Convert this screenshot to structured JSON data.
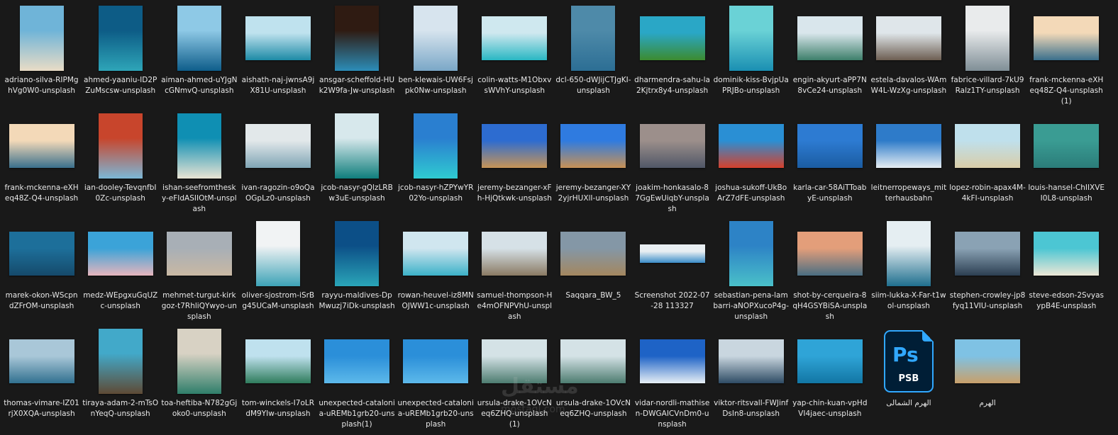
{
  "files": [
    {
      "name": "adriano-silva-RIPMghVg0W0-unsplash",
      "shape": "p",
      "colors": [
        "#6fb4d8",
        "#e9dcc6"
      ]
    },
    {
      "name": "ahmed-yaaniu-ID2PZuMscsw-unsplash",
      "shape": "p",
      "colors": [
        "#0d5c86",
        "#2ea5b8"
      ]
    },
    {
      "name": "aiman-ahmed-uYJgNcGNmvQ-unsplash",
      "shape": "p",
      "colors": [
        "#8ec9e6",
        "#0e5d8a"
      ]
    },
    {
      "name": "aishath-naj-jwnsA9jX81U-unsplash",
      "shape": "l",
      "colors": [
        "#bfe2ee",
        "#1d8aa6"
      ]
    },
    {
      "name": "ansgar-scheffold-HUk2W9fa-Jw-unsplash",
      "shape": "p",
      "colors": [
        "#2f1b12",
        "#2c8db8"
      ]
    },
    {
      "name": "ben-klewais-UW6Fsjpk0Nw-unsplash",
      "shape": "p",
      "colors": [
        "#d7e4ee",
        "#7aa7c7"
      ]
    },
    {
      "name": "colin-watts-M1ObxvsWVhY-unsplash",
      "shape": "l",
      "colors": [
        "#cfe8ef",
        "#29b7c3"
      ]
    },
    {
      "name": "dcl-650-dWJijCTJgKI-unsplash",
      "shape": "p",
      "colors": [
        "#4e8aa9",
        "#2c6e94"
      ]
    },
    {
      "name": "dharmendra-sahu-la2Kjtrx8y4-unsplash",
      "shape": "l",
      "colors": [
        "#2aa7c6",
        "#3c8b2f"
      ]
    },
    {
      "name": "dominik-kiss-BvjpUaPRJBo-unsplash",
      "shape": "p",
      "colors": [
        "#6ad2d6",
        "#1a8fb2"
      ]
    },
    {
      "name": "engin-akyurt-aPP7N8vCe24-unsplash",
      "shape": "l",
      "colors": [
        "#d9e6ec",
        "#3d7f6a"
      ]
    },
    {
      "name": "estela-davalos-WAmW4L-WzXg-unsplash",
      "shape": "l",
      "colors": [
        "#dfe6ea",
        "#6d5e52"
      ]
    },
    {
      "name": "fabrice-villard-7kU9Ralz1TY-unsplash",
      "shape": "p",
      "colors": [
        "#e9ebec",
        "#7f8e96"
      ]
    },
    {
      "name": "frank-mckenna-eXHeq48Z-Q4-unsplash(1)",
      "shape": "l",
      "colors": [
        "#f3d9b8",
        "#3a6f8c"
      ]
    },
    {
      "name": "frank-mckenna-eXHeq48Z-Q4-unsplash",
      "shape": "l",
      "colors": [
        "#f3d9b8",
        "#3a6f8c"
      ]
    },
    {
      "name": "ian-dooley-TevqnfbI0Zc-unsplash",
      "shape": "p",
      "colors": [
        "#c8452c",
        "#7cb7d6"
      ]
    },
    {
      "name": "ishan-seefromthesky-eFIdASIIOtM-unsplash",
      "shape": "p",
      "colors": [
        "#0f8fb3",
        "#e9e4d4"
      ]
    },
    {
      "name": "ivan-ragozin-o9oQaOGpLz0-unsplash",
      "shape": "l",
      "colors": [
        "#e2e8ea",
        "#7fa5b5"
      ]
    },
    {
      "name": "jcob-nasyr-gQlzLRBw3uE-unsplash",
      "shape": "p",
      "colors": [
        "#d7e8ec",
        "#0f7e7c"
      ]
    },
    {
      "name": "jcob-nasyr-hZPYwYR02Yo-unsplash",
      "shape": "p",
      "colors": [
        "#2a7fd0",
        "#2fcbd1"
      ]
    },
    {
      "name": "jeremy-bezanger-xFh-HjQtkwk-unsplash",
      "shape": "l",
      "colors": [
        "#2d6cd0",
        "#c79456"
      ]
    },
    {
      "name": "jeremy-bezanger-XY2yjrHUXlI-unsplash",
      "shape": "l",
      "colors": [
        "#2f7be0",
        "#c89155"
      ]
    },
    {
      "name": "joakim-honkasalo-87GgEwUiqbY-unsplash",
      "shape": "l",
      "colors": [
        "#9c8f8b",
        "#505767"
      ]
    },
    {
      "name": "joshua-sukoff-UkBoArZ7dFE-unsplash",
      "shape": "l",
      "colors": [
        "#2a8fd4",
        "#d5402c"
      ]
    },
    {
      "name": "karla-car-58AiTToabyE-unsplash",
      "shape": "l",
      "colors": [
        "#2d7bd2",
        "#1b5ca1"
      ]
    },
    {
      "name": "leitnerropeways_mitterhausbahn",
      "shape": "l",
      "colors": [
        "#2e7bc9",
        "#e6eef3"
      ]
    },
    {
      "name": "lopez-robin-apax4M-4kFI-unsplash",
      "shape": "l",
      "colors": [
        "#bfe0ec",
        "#d9cda8"
      ]
    },
    {
      "name": "louis-hansel-ChIIXVEI0L8-unsplash",
      "shape": "l",
      "colors": [
        "#3a9c93",
        "#2b7c79"
      ]
    },
    {
      "name": "marek-okon-WScpndZFrOM-unsplash",
      "shape": "l",
      "colors": [
        "#1d6f9a",
        "#154a6b"
      ]
    },
    {
      "name": "medz-WEpgxuGqUZc-unsplash",
      "shape": "l",
      "colors": [
        "#3ba3d8",
        "#e6b5bd"
      ]
    },
    {
      "name": "mehmet-turgut-kirkgoz-t7RhliQYwyo-unsplash",
      "shape": "l",
      "colors": [
        "#a8afb6",
        "#c9b8a3"
      ]
    },
    {
      "name": "oliver-sjostrom-iSrBg45UCaM-unsplash",
      "shape": "p",
      "colors": [
        "#f1f3f4",
        "#3da3b7"
      ]
    },
    {
      "name": "rayyu-maldives-DpMwuzj7iDk-unsplash",
      "shape": "p",
      "colors": [
        "#0c4f87",
        "#2aa5b8"
      ]
    },
    {
      "name": "rowan-heuvel-iz8MNOJWW1c-unsplash",
      "shape": "l",
      "colors": [
        "#d0e6ef",
        "#3cb1c8"
      ]
    },
    {
      "name": "samuel-thompson-He4mOFNPVhU-unsplash",
      "shape": "l",
      "colors": [
        "#d6e1e7",
        "#8a7a63"
      ]
    },
    {
      "name": "Saqqara_BW_5",
      "shape": "l",
      "colors": [
        "#8497a6",
        "#a4875f"
      ]
    },
    {
      "name": "Screenshot 2022-07-28 113327",
      "shape": "w",
      "colors": [
        "#e8eef2",
        "#3a8cc8"
      ]
    },
    {
      "name": "sebastian-pena-lambarri-aNOPXucoP4g-unsplash",
      "shape": "p",
      "colors": [
        "#2d83c6",
        "#4ac0c9"
      ]
    },
    {
      "name": "shot-by-cerqueira-8qH4GSYBiSA-unsplash",
      "shape": "l",
      "colors": [
        "#e39e7a",
        "#4a6e82"
      ]
    },
    {
      "name": "siim-lukka-X-Far-t1wol-unsplash",
      "shape": "p",
      "colors": [
        "#e5eef2",
        "#1f6f8e"
      ]
    },
    {
      "name": "stephen-crowley-jp8fyq11VIU-unsplash",
      "shape": "l",
      "colors": [
        "#8aa2b4",
        "#2c3f52"
      ]
    },
    {
      "name": "steve-edson-2SvyasypB4E-unsplash",
      "shape": "l",
      "colors": [
        "#4cc6d3",
        "#ede7d6"
      ]
    },
    {
      "name": "thomas-vimare-IZ01rjX0XQA-unsplash",
      "shape": "l",
      "colors": [
        "#a9c7d8",
        "#31708f"
      ]
    },
    {
      "name": "tiraya-adam-2-mTsOnYeqQ-unsplash",
      "shape": "p",
      "colors": [
        "#42a9c9",
        "#5e4a35"
      ]
    },
    {
      "name": "toa-heftiba-N782gGjoko0-unsplash",
      "shape": "p",
      "colors": [
        "#d8d2c4",
        "#2f7e6a"
      ]
    },
    {
      "name": "tom-winckels-I7oLRdM9YIw-unsplash",
      "shape": "l",
      "colors": [
        "#bfe1ee",
        "#2f7c5c"
      ]
    },
    {
      "name": "unexpected-catalonia-uREMb1grb20-unsplash(1)",
      "shape": "l",
      "colors": [
        "#2b8fd9",
        "#5db9ea"
      ]
    },
    {
      "name": "unexpected-catalonia-uREMb1grb20-unsplash",
      "shape": "l",
      "colors": [
        "#2b8fd9",
        "#5db9ea"
      ]
    },
    {
      "name": "ursula-drake-1OVcNeq6ZHQ-unsplash(1)",
      "shape": "l",
      "colors": [
        "#d4e2e6",
        "#4d7c70"
      ]
    },
    {
      "name": "ursula-drake-1OVcNeq6ZHQ-unsplash",
      "shape": "l",
      "colors": [
        "#d4e2e6",
        "#4d7c70"
      ]
    },
    {
      "name": "vidar-nordli-mathisen-DWGAICVnDm0-unsplash",
      "shape": "l",
      "colors": [
        "#1e63c6",
        "#e7eff5"
      ]
    },
    {
      "name": "viktor-ritsvall-FWJinfDsIn8-unsplash",
      "shape": "l",
      "colors": [
        "#c9d6df",
        "#2e4b64"
      ]
    },
    {
      "name": "yap-chin-kuan-vpHdVI4jaec-unsplash",
      "shape": "l",
      "colors": [
        "#2fa4d7",
        "#1276a4"
      ]
    },
    {
      "name": "الهرم الشمالى",
      "shape": "psb",
      "colors": [
        "#001e36",
        "#31a8ff"
      ]
    },
    {
      "name": "الهرم",
      "shape": "l",
      "colors": [
        "#7fc2e4",
        "#c9a06a"
      ]
    }
  ],
  "psb_icon": {
    "letters": "Ps",
    "ext": "PSB"
  },
  "watermark": {
    "main": "مستقل",
    "sub": "mostaql.com"
  }
}
